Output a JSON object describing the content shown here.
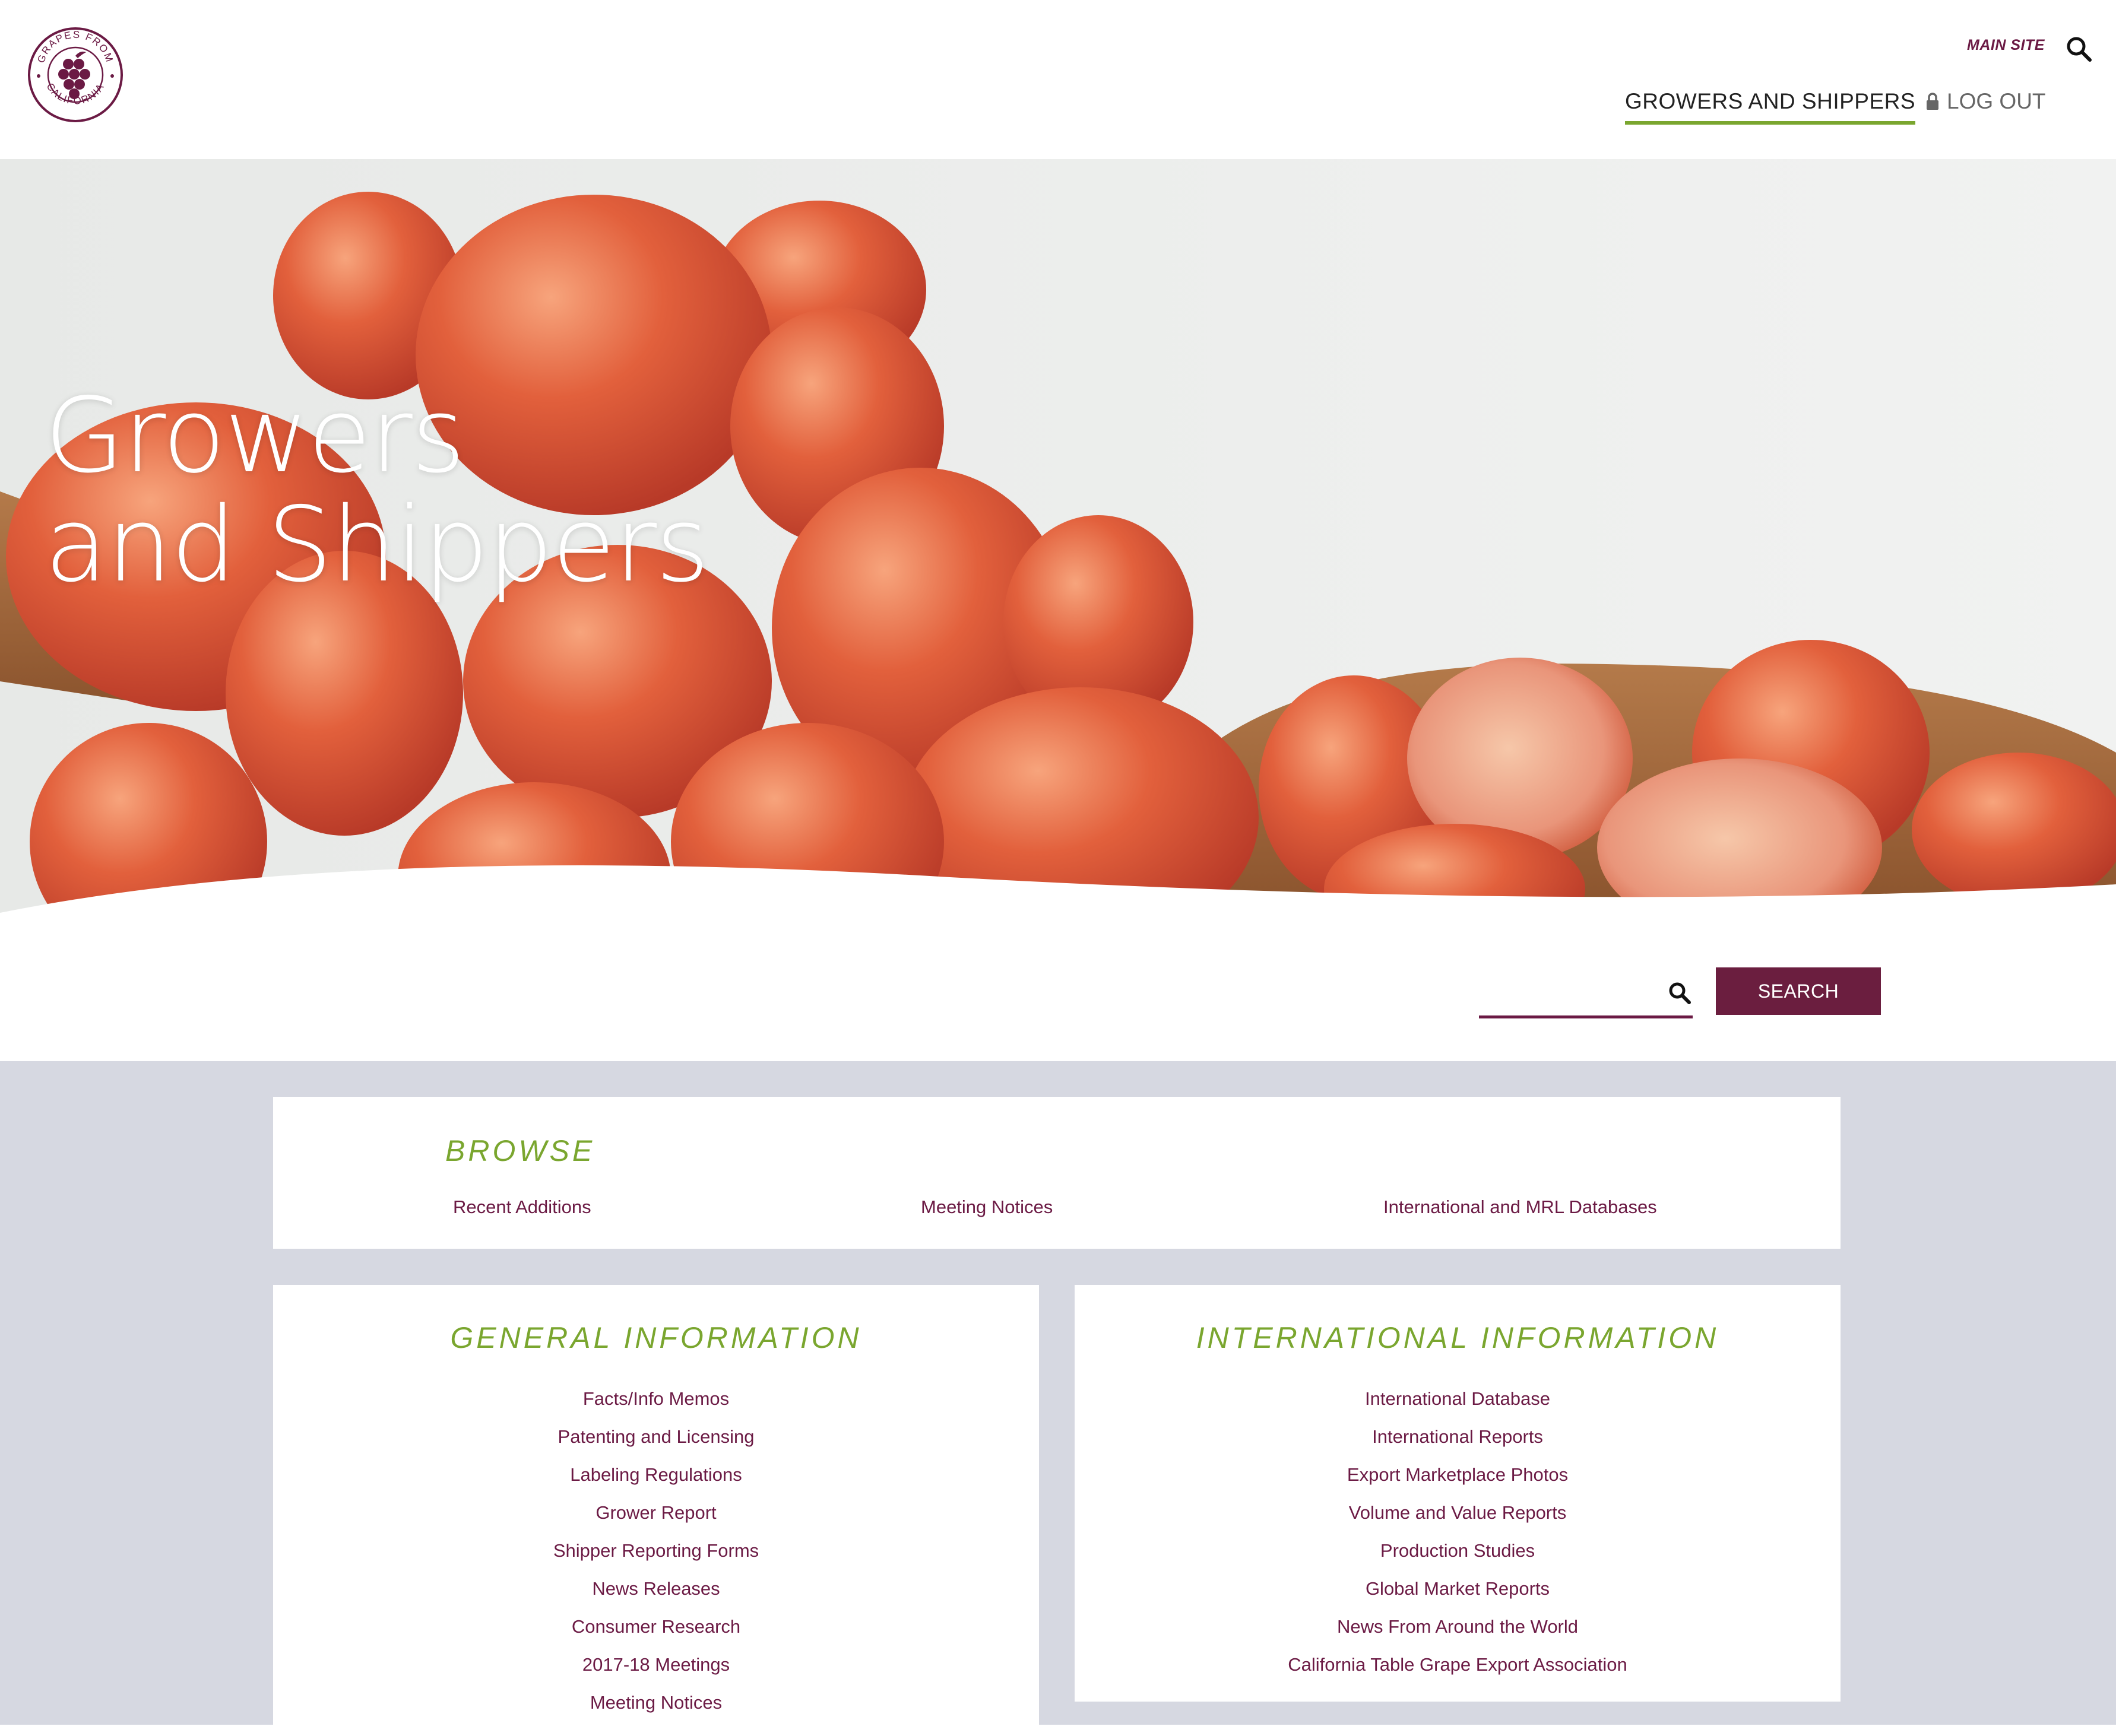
{
  "header": {
    "logo_text": "GRAPES FROM CALIFORNIA",
    "main_site_label": "MAIN SITE",
    "search_icon": "search-icon",
    "nav": {
      "growers_label": "GROWERS AND SHIPPERS",
      "logout_label": "LOG OUT",
      "logout_icon": "lock-icon"
    }
  },
  "hero": {
    "title_line1": "Growers",
    "title_line2": "and Shippers"
  },
  "search": {
    "placeholder": "",
    "value": "",
    "button_label": "SEARCH",
    "icon": "search-icon"
  },
  "browse": {
    "title": "BROWSE",
    "links": [
      "Recent Additions",
      "Meeting Notices",
      "International and MRL Databases"
    ]
  },
  "general": {
    "title": "GENERAL INFORMATION",
    "links": [
      "Facts/Info Memos",
      "Patenting and Licensing",
      "Labeling Regulations",
      "Grower Report",
      "Shipper Reporting Forms",
      "News Releases",
      "Consumer Research",
      "2017-18 Meetings",
      "Meeting Notices"
    ]
  },
  "international": {
    "title": "INTERNATIONAL INFORMATION",
    "links": [
      "International Database",
      "International Reports",
      "Export Marketplace Photos",
      "Volume and Value Reports",
      "Production Studies",
      "Global Market Reports",
      "News From Around the World",
      "California Table Grape Export Association"
    ]
  },
  "colors": {
    "brand_purple": "#6b1a44",
    "accent_green": "#7aa62f",
    "content_bg": "#d6d8e1",
    "button_bg": "#6b1e3f"
  }
}
